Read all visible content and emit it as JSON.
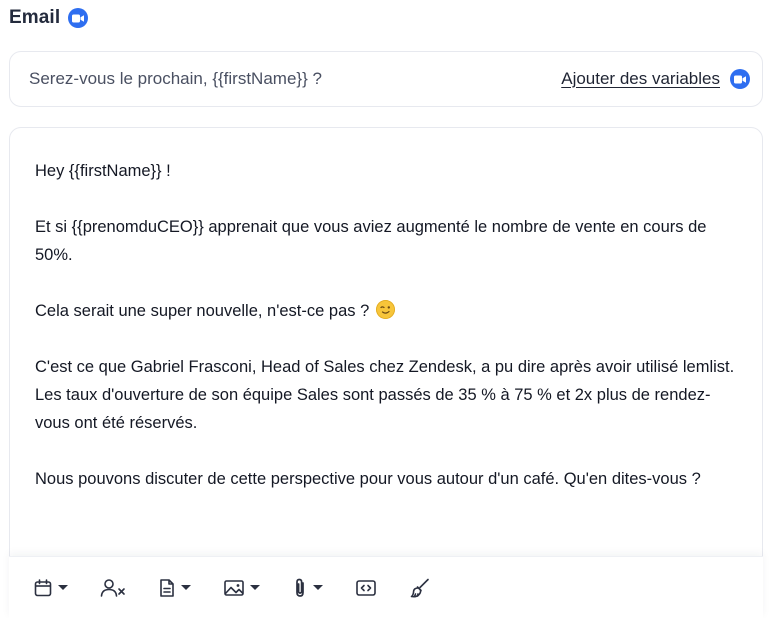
{
  "header": {
    "title": "Email",
    "badge_icon": "video-camera-icon",
    "accent": "#2e6ef0"
  },
  "subject": {
    "value": "Serez-vous le prochain, {{firstName}} ?",
    "add_variables_label": "Ajouter des variables",
    "add_variables_icon": "video-camera-icon"
  },
  "body": {
    "paragraphs": [
      "Hey {{firstName}} !",
      "Et si {{prenomduCEO}} apprenait que vous aviez augmenté le nombre de vente en cours de 50%.",
      "Cela serait une super nouvelle, n'est-ce pas ?",
      "C'est ce que Gabriel Frasconi, Head of Sales chez Zendesk, a pu dire après avoir utilisé lemlist. Les taux d'ouverture de son équipe Sales sont passés de 35 % à 75 % et 2x plus de rendez-vous ont été réservés.",
      "Nous pouvons discuter de cette perspective pour vous autour d'un café. Qu'en dites-vous ?"
    ],
    "emoji": "winking-face-emoji"
  },
  "toolbar": {
    "tools": [
      {
        "icon": "calendar-icon",
        "has_dropdown": true
      },
      {
        "icon": "remove-user-icon",
        "has_dropdown": false
      },
      {
        "icon": "document-icon",
        "has_dropdown": true
      },
      {
        "icon": "image-icon",
        "has_dropdown": true
      },
      {
        "icon": "paperclip-icon",
        "has_dropdown": true
      },
      {
        "icon": "code-icon",
        "has_dropdown": false
      },
      {
        "icon": "paintbrush-icon",
        "has_dropdown": false
      }
    ]
  }
}
